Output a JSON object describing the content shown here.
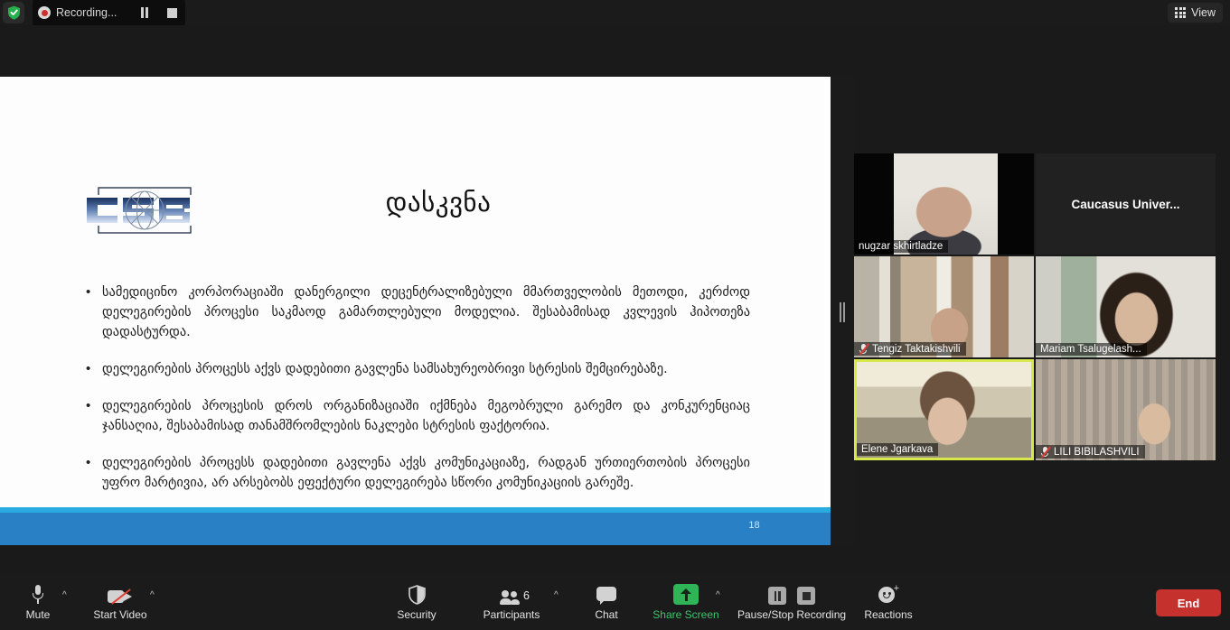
{
  "top_bar": {
    "shield_icon": "shield-check-icon",
    "recording_label": "Recording...",
    "pause_icon": "pause-icon",
    "stop_icon": "stop-icon",
    "view_label": "View",
    "view_icon": "grid-icon"
  },
  "slide": {
    "logo_text": "CSB",
    "title": "დასკვნა",
    "bullet_marker": "•",
    "bullets": [
      "სამედიცინო კორპორაციაში დანერგილი დეცენტრალიზებული მმართველობის მეთოდი, კერძოდ დელეგირების პროცესი საკმაოდ გამართლებული მოდელია. შესაბამისად კვლევის ჰიპოთეზა დადასტურდა.",
      "დელეგირების პროცესს აქვს დადებითი გავლენა სამსახურეობრივი სტრესის შემცირებაზე.",
      "დელეგირების პროცესის დროს ორგანიზაციაში იქმნება მეგობრული გარემო და კონკურენციაც ჯანსაღია, შესაბამისად თანამშრომლების ნაკლები სტრესის ფაქტორია.",
      "დელეგირების პროცესს დადებითი გავლენა აქვს კომუნიკაციაზე, რადგან ურთიერთობის პროცესი უფრო მარტივია, არ არსებობს ეფექტური დელეგირება სწორი კომუნიკაციის გარეშე."
    ],
    "page_number": "18",
    "footer_color": "#2980c4",
    "footer_stripe_color": "#29abe2"
  },
  "divider": {
    "handle_icon": "drag-handle-icon"
  },
  "video_grid": {
    "tiles": [
      {
        "name": "nugzar skhirtladze",
        "has_video": true,
        "muted": false,
        "speaking": false,
        "name_position": "bottom-left"
      },
      {
        "name": "Caucasus Univer...",
        "has_video": false,
        "muted": false,
        "speaking": false,
        "name_position": "center"
      },
      {
        "name": "Tengiz Taktakishvili",
        "has_video": true,
        "muted": true,
        "speaking": false,
        "name_position": "bottom-left"
      },
      {
        "name": "Mariam Tsalugelash...",
        "has_video": true,
        "muted": false,
        "speaking": false,
        "name_position": "bottom-left"
      },
      {
        "name": "Elene Jgarkava",
        "has_video": true,
        "muted": false,
        "speaking": true,
        "name_position": "bottom-left"
      },
      {
        "name": "LILI BIBILASHVILI",
        "has_video": true,
        "muted": true,
        "speaking": false,
        "name_position": "bottom-left"
      }
    ],
    "speaking_border_color": "#d7e84b",
    "mic_muted_color": "#e03c31"
  },
  "toolbar": {
    "mute_label": "Mute",
    "mute_icon": "microphone-icon",
    "start_video_label": "Start Video",
    "start_video_icon": "camera-off-icon",
    "security_label": "Security",
    "security_icon": "shield-icon",
    "participants_label": "Participants",
    "participants_icon": "people-icon",
    "participants_count": "6",
    "chat_label": "Chat",
    "chat_icon": "chat-bubble-icon",
    "share_screen_label": "Share Screen",
    "share_screen_icon": "share-up-arrow-icon",
    "share_screen_color": "#2fb457",
    "pause_stop_recording_label": "Pause/Stop Recording",
    "pause_recording_icon": "pause-icon",
    "stop_recording_icon": "stop-icon",
    "reactions_label": "Reactions",
    "reactions_icon": "smiley-plus-icon",
    "end_label": "End",
    "end_color": "#c5322e",
    "caret_icon": "chevron-up-icon"
  }
}
